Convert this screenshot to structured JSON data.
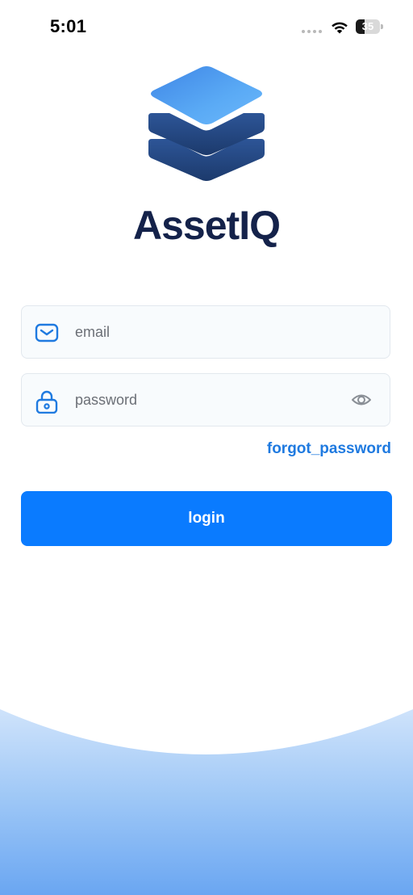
{
  "status_bar": {
    "time": "5:01",
    "battery_level": "35",
    "battery_fraction": 0.35
  },
  "brand": {
    "name": "AssetIQ",
    "logo_icon": "stacked-layers-icon"
  },
  "login_form": {
    "email_placeholder": "email",
    "password_placeholder": "password",
    "email_icon": "mail-icon",
    "password_icon": "lock-icon",
    "visibility_icon": "eye-icon",
    "forgot_password_label": "forgot_password",
    "login_label": "login"
  },
  "colors": {
    "primary": "#0a7bff",
    "link": "#1f7ae0",
    "brand_text": "#14224a",
    "logo_top": "#4a9bef",
    "logo_layers": "#22447a"
  }
}
